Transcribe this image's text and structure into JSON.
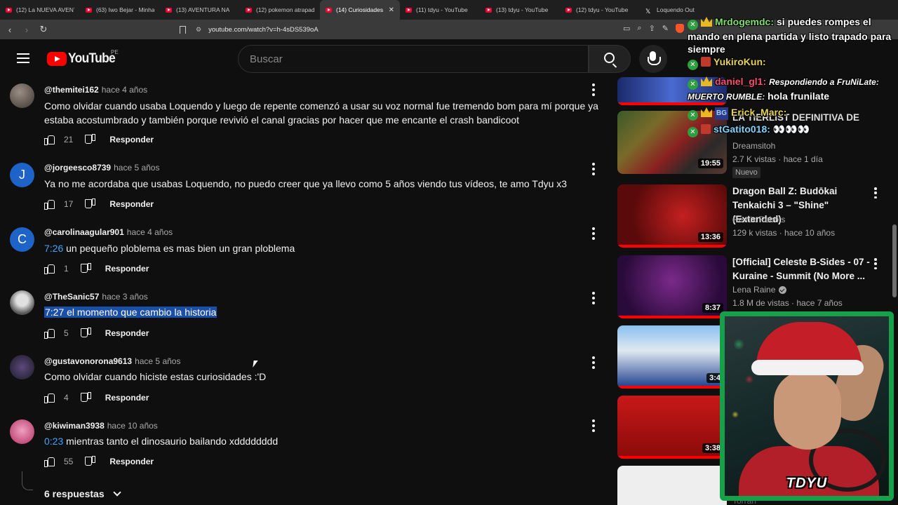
{
  "browser": {
    "tabs": [
      {
        "label": "(12) La NUEVA AVENT",
        "icon": "youtube-icon",
        "active": false
      },
      {
        "label": "(63) Iwo Bejar - Minha",
        "icon": "youtube-icon",
        "active": false
      },
      {
        "label": "(13) AVENTURA NA",
        "icon": "youtube-icon",
        "active": false
      },
      {
        "label": "(12) pokemon atrapad",
        "icon": "youtube-icon",
        "active": false
      },
      {
        "label": "(14) Curiosidades",
        "icon": "youtube-icon",
        "active": true
      },
      {
        "label": "(11) tdyu - YouTube",
        "icon": "youtube-icon",
        "active": false
      },
      {
        "label": "(13) tdyu - YouTube",
        "icon": "youtube-icon",
        "active": false
      },
      {
        "label": "(12) tdyu - YouTube",
        "icon": "youtube-icon",
        "active": false
      },
      {
        "label": "Loquendo Out",
        "icon": "x-icon",
        "active": false
      }
    ],
    "url": "youtube.com/watch?v=h-4sDS539oA"
  },
  "youtube": {
    "logo_text": "YouTube",
    "country": "PE",
    "search_placeholder": "Buscar"
  },
  "comments": [
    {
      "author": "@themitei162",
      "time": "hace 4 años",
      "text": "Como olvidar cuando usaba Loquendo y luego de repente comenzó a usar su voz normal fue tremendo bom para mí porque ya estaba acostumbrado y también porque revivió el canal gracias por hacer que me encante el crash bandicoot",
      "likes": "21",
      "reply": "Responder"
    },
    {
      "author": "@jorgeesco8739",
      "time": "hace 5 años",
      "text": "Ya no me acordaba que usabas Loquendo, no puedo creer que ya llevo como 5 años viendo tus vídeos, te amo Tdyu x3",
      "likes": "17",
      "reply": "Responder",
      "avatar_letter": "J"
    },
    {
      "author": "@carolinaagular901",
      "time": "hace 4 años",
      "timestamp": "7:26",
      "text": "un pequeño ploblema es mas bien un gran ploblema",
      "likes": "1",
      "reply": "Responder",
      "avatar_letter": "C"
    },
    {
      "author": "@TheSanic57",
      "time": "hace 3 años",
      "text": "7:27 el momento que cambio la historia",
      "likes": "5",
      "reply": "Responder"
    },
    {
      "author": "@gustavonorona9613",
      "time": "hace 5 años",
      "text": "Como olvidar cuando hiciste estas curiosidades :'D",
      "likes": "4",
      "reply": "Responder"
    },
    {
      "author": "@kiwiman3938",
      "time": "hace 10 años",
      "timestamp": "0:23",
      "text": "mientras tanto el dinosaurio bailando xdddddddd",
      "likes": "55",
      "reply": "Responder"
    }
  ],
  "replies_toggle": "6 respuestas",
  "recommendations": [
    {
      "title": "LA TIERLIST DEFINITIVA DE",
      "channel": "Dreamsitoh",
      "meta": "2.7 K vistas · hace 1 día",
      "badge": "Nuevo",
      "duration": "19:55"
    },
    {
      "title": "Dragon Ball Z: Budōkai Tenkaichi 3 – \"Shine\" (Extended)",
      "channel": "Remix Robots",
      "meta": "129 k vistas · hace 10 años",
      "duration": "13:36"
    },
    {
      "title": "[Official] Celeste B-Sides - 07 - Kuraine - Summit (No More ...",
      "channel": "Lena Raine",
      "meta": "1.8 M de vistas · hace 7 años",
      "duration": "8:37"
    },
    {
      "title": "",
      "channel": "",
      "meta": "",
      "duration": "3:4"
    },
    {
      "title": "",
      "channel": "",
      "meta": "",
      "duration": "3:38"
    },
    {
      "title": "",
      "channel": "Torrari",
      "meta": "",
      "duration": ""
    }
  ],
  "chat": [
    {
      "name": "Mrdogemdc:",
      "message": "si puedes rompes el mando en plena partida y listo trapado para siempre",
      "name_color": "#7ee06b",
      "italic": false
    },
    {
      "name": "YukiroKun:",
      "message": "",
      "name_color": "#e8d44d",
      "italic": false
    },
    {
      "name": "daniel_gl1:",
      "message": "Respondiendo a FruNiLate: MUERTO RUMBLE:",
      "message2": "hola frunilate",
      "name_color": "#ff4d6d",
      "italic": true
    },
    {
      "name": "Erick_Marc:",
      "message": "",
      "name_color": "#e8d44d",
      "italic": false
    },
    {
      "name": "stGatito018:",
      "message": "👀👀👀",
      "name_color": "#7fd4ff",
      "italic": false
    }
  ],
  "webcam": {
    "label": "TDYU"
  },
  "colors": {
    "accent": "#ff0000",
    "link": "#3ea6ff",
    "highlight": "#1a4fa8",
    "webcam_border": "#17a04a"
  }
}
